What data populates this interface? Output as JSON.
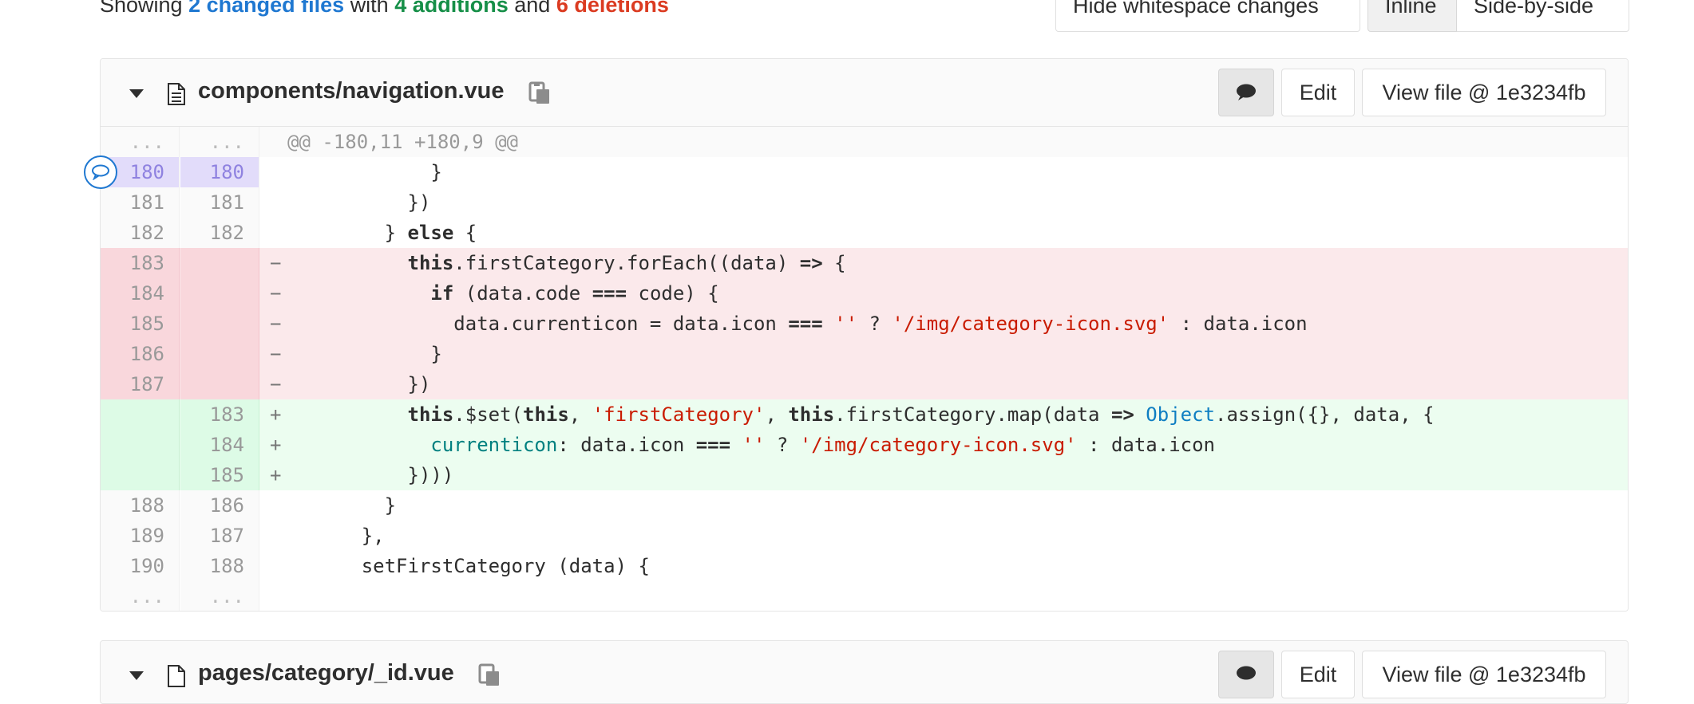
{
  "summary": {
    "showing": "Showing",
    "changed_files": "2 changed files",
    "with": "with",
    "additions": "4 additions",
    "and": "and",
    "deletions": "6 deletions"
  },
  "toolbar": {
    "hide_whitespace": "Hide whitespace changes",
    "inline": "Inline",
    "side_by_side": "Side-by-side"
  },
  "file1": {
    "name": "components/navigation.vue",
    "edit_label": "Edit",
    "view_file_label": "View file @ 1e3234fb",
    "hunk_header": "@@ -180,11 +180,9 @@",
    "match_dots": "...",
    "lines": {
      "l1": {
        "old": "180",
        "new": "180"
      },
      "l2": {
        "old": "181",
        "new": "181"
      },
      "l3": {
        "old": "182",
        "new": "182"
      },
      "l4": {
        "old": "183",
        "new": "",
        "sign": "−"
      },
      "l5": {
        "old": "184",
        "new": "",
        "sign": "−"
      },
      "l6": {
        "old": "185",
        "new": "",
        "sign": "−"
      },
      "l7": {
        "old": "186",
        "new": "",
        "sign": "−"
      },
      "l8": {
        "old": "187",
        "new": "",
        "sign": "−"
      },
      "l9": {
        "old": "",
        "new": "183",
        "sign": "+"
      },
      "l10": {
        "old": "",
        "new": "184",
        "sign": "+"
      },
      "l11": {
        "old": "",
        "new": "185",
        "sign": "+"
      },
      "l12": {
        "old": "188",
        "new": "186"
      },
      "l13": {
        "old": "189",
        "new": "187"
      },
      "l14": {
        "old": "190",
        "new": "188"
      }
    }
  },
  "file2": {
    "name": "pages/category/_id.vue",
    "edit_label": "Edit",
    "view_file_label": "View file @ 1e3234fb"
  },
  "colors": {
    "link_blue": "#1f78d1",
    "addition_green": "#168f48",
    "deletion_red": "#db3b21",
    "deleted_line_bg": "#fbe9eb",
    "added_line_bg": "#ecfdf0",
    "highlight_line_bg": "#e2dcfa"
  },
  "icons": {
    "collapse": "caret-down-icon",
    "file": "file-icon",
    "copy": "clipboard-icon",
    "comments": "comment-icon",
    "add_comment": "comment-bubble-icon"
  }
}
